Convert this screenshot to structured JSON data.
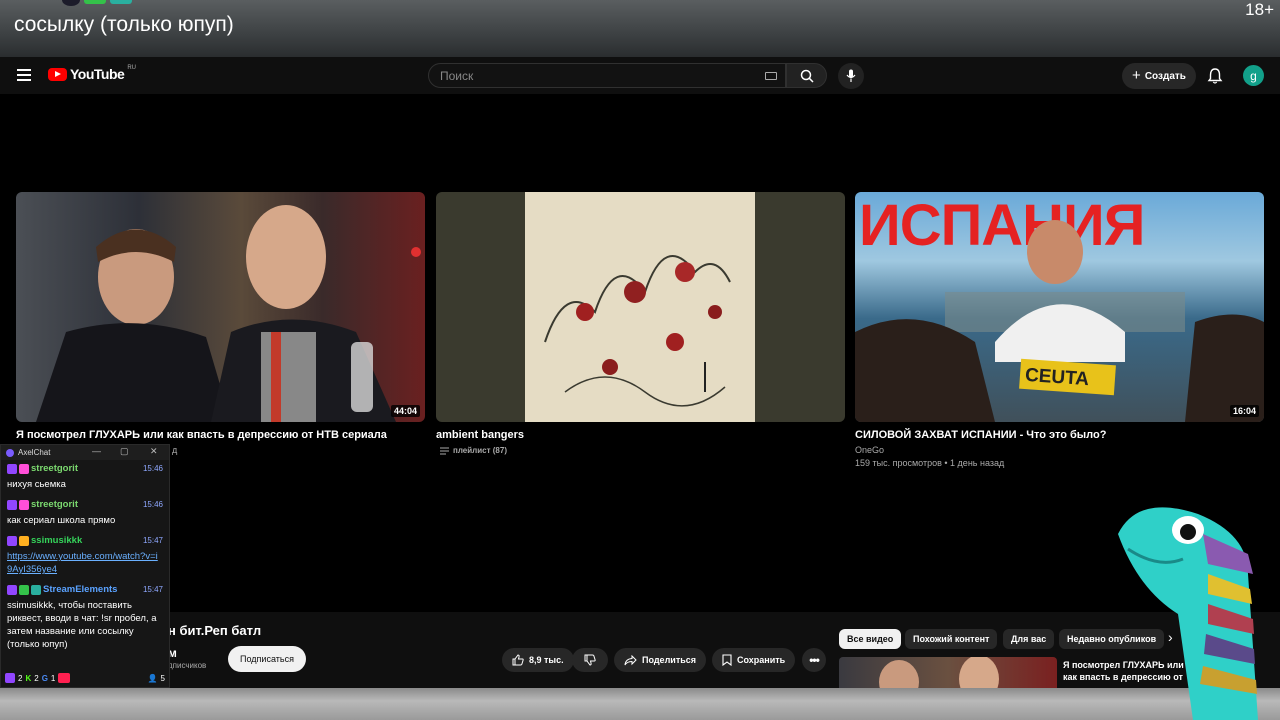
{
  "overlay": {
    "banner_text": "сосылку (только юпуп)",
    "age_rating": "18+"
  },
  "header": {
    "logo_text": "YouTube",
    "logo_country": "RU",
    "search_placeholder": "Поиск",
    "create_label": "Создать",
    "avatar_letter": "g"
  },
  "videos": [
    {
      "title": "Я посмотрел ГЛУХАРЬ или как впасть в депрессию от НТВ сериала",
      "duration": "44:04",
      "meta_tail": "д"
    },
    {
      "title": "ambient bangers",
      "playlist": "плейлист (87)"
    },
    {
      "title": "СИЛОВОЙ ЗАХВАТ ИСПАНИИ - Что это было?",
      "channel": "OneGo",
      "stats": "159 тыс. просмотров • 1 день назад",
      "duration": "16:04",
      "thumb_text": "ИСПАНИЯ",
      "sign_text": "CEUTA"
    }
  ],
  "watch": {
    "title": "н бит.Реп батл",
    "channel": "м",
    "subscribers": "дписчиков",
    "subscribe_label": "Подписаться",
    "likes": "8,9 тыс.",
    "share_label": "Поделиться",
    "save_label": "Сохранить"
  },
  "chips": [
    "Все видео",
    "Похожий контент",
    "Для вас",
    "Недавно опубликов"
  ],
  "related": {
    "title": "Я посмотрел ГЛУХАРЬ или как впасть в депрессию от"
  },
  "chat": {
    "app_title": "AxelChat",
    "messages": [
      {
        "user": "streetgorit",
        "time": "15:46",
        "text": "нихуя сьемка"
      },
      {
        "user": "streetgorit",
        "time": "15:46",
        "text": "как сериал школа прямо"
      },
      {
        "user": "ssimusikkk",
        "time": "15:47",
        "link": "https://www.youtube.com/watch?v=i9AyI356ye4"
      },
      {
        "user": "StreamElements",
        "time": "15:47",
        "text": "ssimusikkk, чтобы поставить риквест, вводи в чат: !sr пробел, а затем название или сосылку (только юпуп)"
      }
    ],
    "footer": {
      "twitch": "2",
      "kick": "2",
      "google": "1",
      "viewers": "5"
    }
  },
  "colors": {
    "streetgorit": "#7bd96f",
    "ssimusikkk": "#35d35a",
    "streamelements": "#5aa2ff",
    "youtube_red": "#ff0000"
  }
}
